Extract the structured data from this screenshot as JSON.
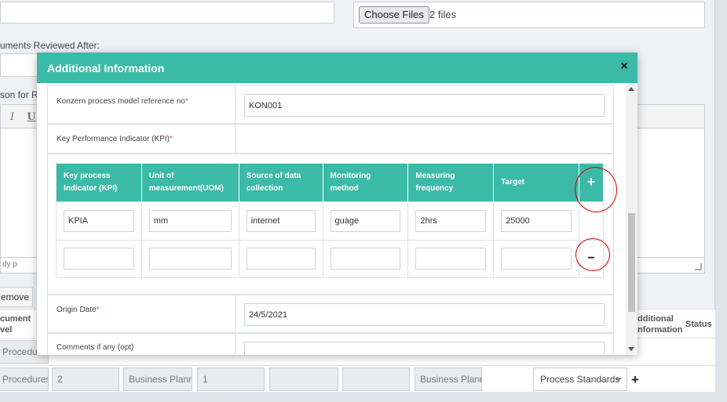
{
  "background": {
    "choose_files_label": "Choose Files",
    "file_count": "2 files",
    "documents_reviewed_label": "uments Reviewed After:",
    "reason_label": "son for R",
    "toolbar_italic": "I",
    "toolbar_underline": "U",
    "editor_status": "dy  p",
    "remove_label": "emove",
    "col_document_level": "cument\nvel",
    "col_additional_info": "dditional\nnformation",
    "col_status": "Status",
    "rows": [
      {
        "c1": "Procedur"
      },
      {
        "c1": "Procedures",
        "c2": "2",
        "c3": "Business Planr",
        "c4": "1",
        "c7": "Business Planr",
        "select": "Process Standards",
        "plus": "+"
      }
    ]
  },
  "modal": {
    "title": "Additional Information",
    "close": "×",
    "fields": {
      "konzern_label": "Konzern process model reference no",
      "konzern_value": "KON001",
      "kpi_label": "Key Performance Indicator (KPI)",
      "origin_label": "Origin Date",
      "origin_value": "24/5/2021",
      "comments_label": "Comments if any (opt)",
      "required_mark": "*"
    },
    "kpi_table": {
      "headers": [
        "Key process Indicator (KPI)",
        "Unit of measurement(UOM)",
        "Source of data collection",
        "Monitoring method",
        "Measuring frequency",
        "Target"
      ],
      "add_label": "+",
      "remove_label": "−",
      "rows": [
        [
          "KPIA",
          "mm",
          "internet",
          "guage",
          "2hrs",
          "25000"
        ],
        [
          "",
          "",
          "",
          "",
          "",
          ""
        ]
      ]
    }
  }
}
